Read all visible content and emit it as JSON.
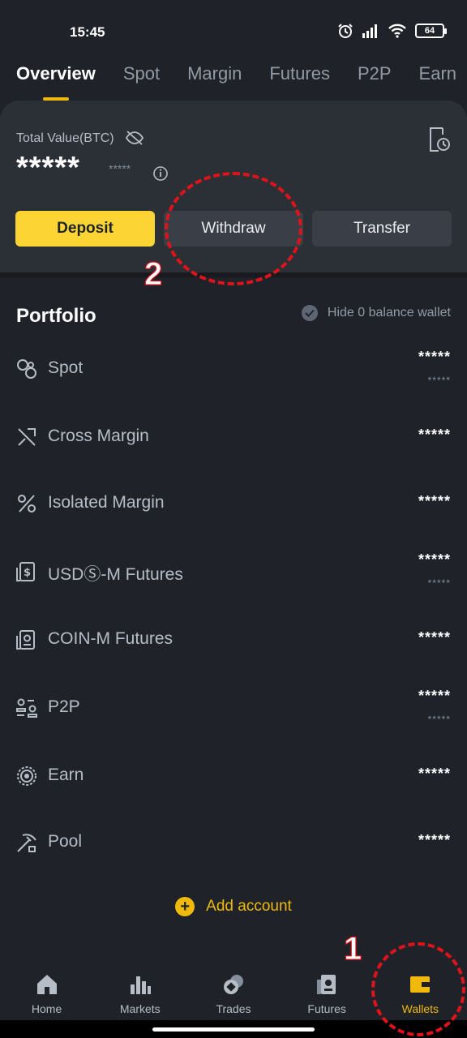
{
  "status": {
    "time": "15:45",
    "battery": "64"
  },
  "tabs": [
    "Overview",
    "Spot",
    "Margin",
    "Futures",
    "P2P",
    "Earn"
  ],
  "summary": {
    "label": "Total Value(BTC)",
    "value": "*****",
    "sub_value": "*****",
    "buttons": {
      "deposit": "Deposit",
      "withdraw": "Withdraw",
      "transfer": "Transfer"
    }
  },
  "portfolio": {
    "title": "Portfolio",
    "hide_label": "Hide 0 balance wallet",
    "rows": [
      {
        "name": "Spot",
        "icon": "spot-icon",
        "value": "*****",
        "sub": "*****"
      },
      {
        "name": "Cross Margin",
        "icon": "cross-margin-icon",
        "value": "*****",
        "sub": ""
      },
      {
        "name": "Isolated Margin",
        "icon": "isolated-margin-icon",
        "value": "*****",
        "sub": ""
      },
      {
        "name": "USDⓈ-M Futures",
        "icon": "usds-futures-icon",
        "value": "*****",
        "sub": "*****"
      },
      {
        "name": "COIN-M Futures",
        "icon": "coin-futures-icon",
        "value": "*****",
        "sub": ""
      },
      {
        "name": "P2P",
        "icon": "p2p-icon",
        "value": "*****",
        "sub": "*****"
      },
      {
        "name": "Earn",
        "icon": "earn-icon",
        "value": "*****",
        "sub": ""
      },
      {
        "name": "Pool",
        "icon": "pool-icon",
        "value": "*****",
        "sub": ""
      }
    ],
    "add_account": "Add account"
  },
  "nav": [
    {
      "label": "Home",
      "icon": "home-icon"
    },
    {
      "label": "Markets",
      "icon": "markets-icon"
    },
    {
      "label": "Trades",
      "icon": "trades-icon"
    },
    {
      "label": "Futures",
      "icon": "futures-icon"
    },
    {
      "label": "Wallets",
      "icon": "wallet-icon"
    }
  ],
  "annotations": {
    "one": "1",
    "two": "2"
  },
  "colors": {
    "accent": "#f0b90b",
    "background": "#1f2329",
    "card": "#2b2f36",
    "annotation": "#e0131a"
  }
}
